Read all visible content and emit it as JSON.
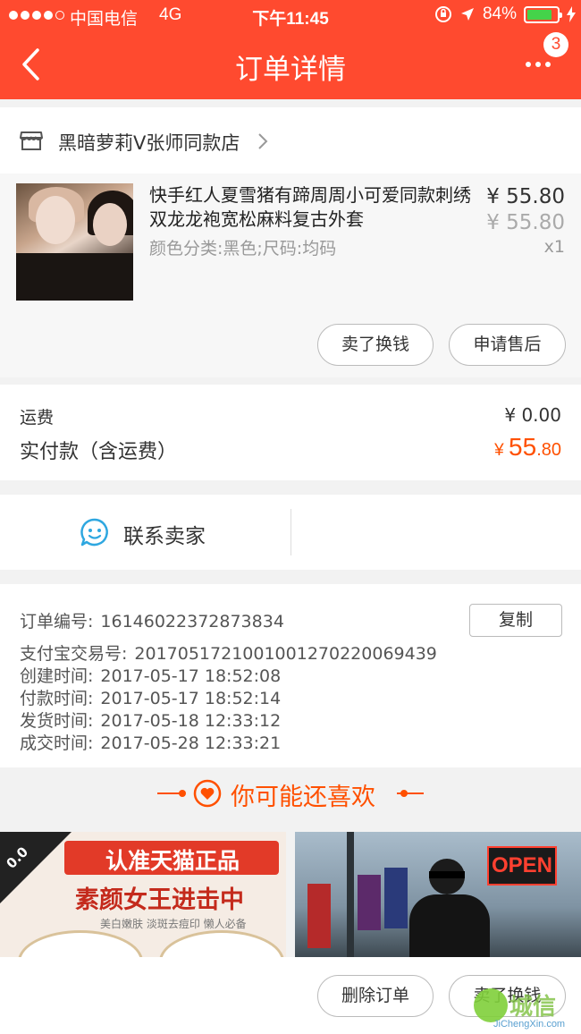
{
  "status_bar": {
    "carrier": "中国电信",
    "network": "4G",
    "time": "下午11:45",
    "battery": "84%",
    "battery_level": 0.84,
    "signal_bars": 4
  },
  "nav": {
    "title": "订单详情",
    "badge_count": "3"
  },
  "shop": {
    "name": "黑暗萝莉V张师同款店"
  },
  "product": {
    "title": "快手红人夏雪猪有蹄周周小可爱同款刺绣双龙龙袍宽松麻料复古外套",
    "spec": "颜色分类:黑色;尺码:均码",
    "price": "¥ 55.80",
    "original_price": "¥ 55.80",
    "quantity": "x1",
    "buttons": {
      "resell": "卖了换钱",
      "after_sale": "申请售后"
    }
  },
  "fees": {
    "shipping_label": "运费",
    "shipping_value": "¥ 0.00",
    "paid_label": "实付款（含运费）",
    "paid_currency": "¥ ",
    "paid_integer": "55",
    "paid_decimal": ".80"
  },
  "contact": {
    "label": "联系卖家"
  },
  "order_info": {
    "copy_button": "复制",
    "rows": [
      {
        "label": "订单编号:",
        "value": "16146022372873834"
      },
      {
        "label": "支付宝交易号:",
        "value": "2017051721001001270220069439"
      },
      {
        "label": "创建时间:",
        "value": "2017-05-17 18:52:08"
      },
      {
        "label": "付款时间:",
        "value": "2017-05-17 18:52:14"
      },
      {
        "label": "发货时间:",
        "value": "2017-05-18 12:33:12"
      },
      {
        "label": "成交时间:",
        "value": "2017-05-28 12:33:21"
      }
    ]
  },
  "recommend": {
    "title": "你可能还喜欢",
    "item1": {
      "banner": "认准天猫正品",
      "headline": "素颜女王进击中",
      "subtext": "美白嫩肤 淡斑去痘印 懒人必备",
      "corner": "0.0"
    },
    "item2": {
      "sign": "OPEN"
    }
  },
  "bottom_bar": {
    "delete": "删除订单",
    "resell": "卖了换钱"
  },
  "watermark": {
    "text": "城信",
    "url": "JiChengXin.com"
  },
  "colors": {
    "brand": "#ff4a2f",
    "price_accent": "#ff5000",
    "contact_icon": "#2ea7e0"
  }
}
